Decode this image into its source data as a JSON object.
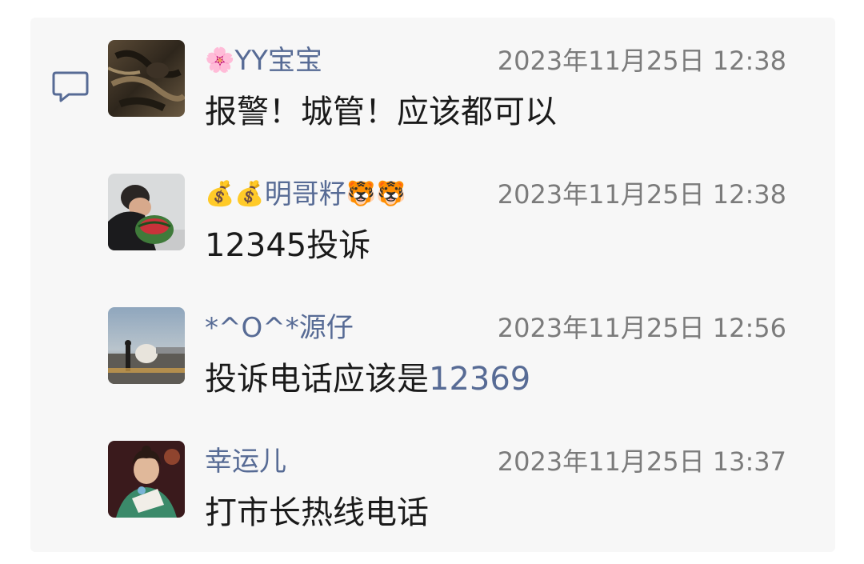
{
  "comments": [
    {
      "name_prefix_emoji": "🌸",
      "name": "YY宝宝",
      "name_suffix_emoji": "",
      "time": "2023年11月25日 12:38",
      "text": "报警！城管！应该都可以",
      "link_text": ""
    },
    {
      "name_prefix_emoji": "💰💰",
      "name": "明哥籽",
      "name_suffix_emoji": "🐯🐯",
      "time": "2023年11月25日 12:38",
      "text": "12345投诉",
      "link_text": ""
    },
    {
      "name_prefix_emoji": "",
      "name": "*^O^*源仔",
      "name_suffix_emoji": "",
      "time": "2023年11月25日 12:56",
      "text": "投诉电话应该是",
      "link_text": "12369"
    },
    {
      "name_prefix_emoji": "",
      "name": "幸运儿",
      "name_suffix_emoji": "",
      "time": "2023年11月25日 13:37",
      "text": "打市长热线电话",
      "link_text": ""
    }
  ],
  "colors": {
    "panel_bg": "#f7f7f7",
    "name": "#576b95",
    "time": "#7b7b7b",
    "text": "#1a1a1a"
  },
  "icons": {
    "comment": "comment-bubble-icon"
  }
}
